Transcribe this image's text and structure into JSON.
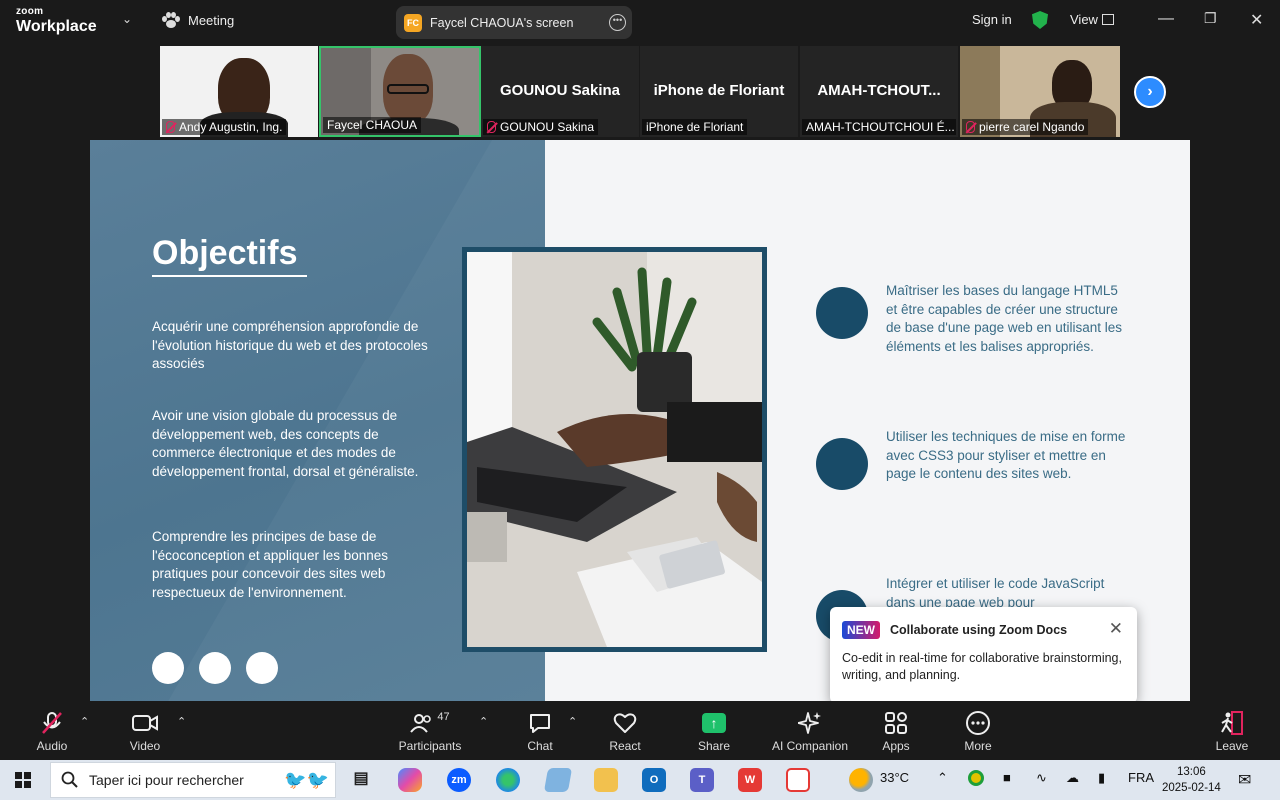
{
  "topbar": {
    "logo_line1": "zoom",
    "logo_line2": "Workplace",
    "meeting_label": "Meeting",
    "share_initials": "FC",
    "share_title": "Faycel CHAOUA's screen",
    "sign_in": "Sign in",
    "view_label": "View"
  },
  "participants": [
    {
      "name": "Andy Augustin, Ing.",
      "muted": true
    },
    {
      "name": "Faycel CHAOUA",
      "muted": false
    },
    {
      "name": "GOUNOU Sakina",
      "display": "GOUNOU Sakina",
      "muted": true
    },
    {
      "name": "iPhone de Floriant",
      "display": "iPhone de Floriant",
      "muted": false
    },
    {
      "name": "AMAH-TCHOUTCHOUI É...",
      "display": "AMAH-TCHOUT...",
      "muted": false
    },
    {
      "name": "pierre carel Ngando",
      "muted": true
    }
  ],
  "slide": {
    "title": "Objectifs",
    "left_items": [
      "Acquérir une compréhension approfondie de l'évolution historique du web et des protocoles associés",
      "Avoir une vision globale du processus de développement web, des concepts de commerce électronique et des modes de développement frontal, dorsal et généraliste.",
      "Comprendre les principes de base de l'écoconception et appliquer les bonnes pratiques pour concevoir des sites web respectueux de l'environnement."
    ],
    "right_items": [
      "Maîtriser les bases du langage HTML5 et être capables de créer une structure de base d'une page web en utilisant les éléments et les balises appropriés.",
      "Utiliser les techniques de mise en forme avec CSS3 pour styliser et mettre en page le contenu des sites web.",
      "Intégrer et utiliser le code JavaScript dans une page web pour"
    ]
  },
  "popup": {
    "tag": "NEW",
    "title": "Collaborate using Zoom Docs",
    "body": "Co-edit in real-time for collaborative brainstorming, writing, and planning."
  },
  "toolbar": {
    "audio": "Audio",
    "video": "Video",
    "participants": "Participants",
    "participants_count": "47",
    "chat": "Chat",
    "react": "React",
    "share": "Share",
    "ai": "AI Companion",
    "apps": "Apps",
    "more": "More",
    "leave": "Leave"
  },
  "taskbar": {
    "search_placeholder": "Taper ici pour rechercher",
    "zm_label": "zm",
    "outlook_label": "O",
    "teams_label": "T",
    "wps_label": "W",
    "temperature": "33°C",
    "language": "FRA",
    "time": "13:06",
    "date": "2025-02-14"
  }
}
